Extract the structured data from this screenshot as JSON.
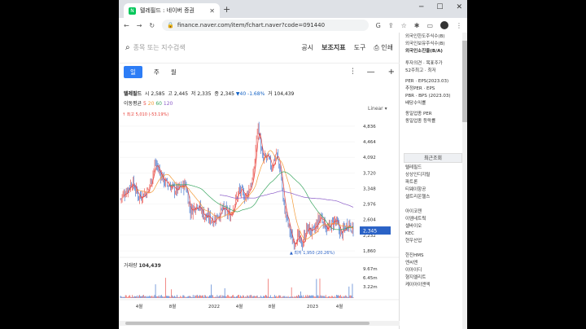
{
  "browser": {
    "tab_title": "텔레필드 : 네이버 증권",
    "favicon": "N",
    "url": "finance.naver.com/item/fchart.naver?code=091440"
  },
  "header": {
    "search_placeholder": "종목 또는 지수검색",
    "nav": [
      "공시",
      "보조지표",
      "도구",
      "인쇄"
    ]
  },
  "period_tabs": [
    "일",
    "주",
    "월"
  ],
  "info": {
    "name": "텔레필드",
    "open_label": "시",
    "open": "2,585",
    "high_label": "고",
    "high": "2,445",
    "low_label": "저",
    "low": "2,335",
    "close_label": "종",
    "close": "2,345",
    "change": "▼40 -1.68%",
    "volume_label": "거",
    "volume": "104,439"
  },
  "ma": {
    "label": "이동평균",
    "periods": [
      "5",
      "20",
      "60",
      "120"
    ]
  },
  "scale_label": "Linear",
  "colors": {
    "up": "#e8413a",
    "down": "#2a62c6",
    "ma5": "#e8413a",
    "ma20": "#f29a38",
    "ma60": "#3aa660",
    "ma120": "#8b5cc8",
    "accent": "#2d7df6"
  },
  "chart_data": {
    "type": "candlestick",
    "y_ticks": [
      "4,836",
      "4,464",
      "4,092",
      "3,720",
      "3,348",
      "2,976",
      "2,604",
      "2,232",
      "1,860"
    ],
    "ylim": [
      1860,
      5010
    ],
    "x_ticks": [
      "4월",
      "8월",
      "2022",
      "4월",
      "8월",
      "2023",
      "4월"
    ],
    "last_price": "2,345",
    "max_label": "최고 5,010 (-53.19%)",
    "min_label": "최저 1,950 (20.26%)",
    "volume_label": "거래량",
    "volume_value": "104,439",
    "volume_ticks": [
      "9.67m",
      "6.45m",
      "3.22m"
    ],
    "trend": [
      {
        "x": 0,
        "y": 3100
      },
      {
        "x": 5,
        "y": 3500
      },
      {
        "x": 8,
        "y": 3150
      },
      {
        "x": 12,
        "y": 3300
      },
      {
        "x": 15,
        "y": 3950
      },
      {
        "x": 19,
        "y": 3500
      },
      {
        "x": 24,
        "y": 3300
      },
      {
        "x": 28,
        "y": 3450
      },
      {
        "x": 30,
        "y": 2800
      },
      {
        "x": 33,
        "y": 3000
      },
      {
        "x": 36,
        "y": 2700
      },
      {
        "x": 40,
        "y": 2600
      },
      {
        "x": 44,
        "y": 2850
      },
      {
        "x": 47,
        "y": 2700
      },
      {
        "x": 51,
        "y": 3300
      },
      {
        "x": 54,
        "y": 3150
      },
      {
        "x": 57,
        "y": 3600
      },
      {
        "x": 59,
        "y": 4900
      },
      {
        "x": 61,
        "y": 4000
      },
      {
        "x": 63,
        "y": 4100
      },
      {
        "x": 65,
        "y": 3850
      },
      {
        "x": 67,
        "y": 4200
      },
      {
        "x": 69,
        "y": 3700
      },
      {
        "x": 70,
        "y": 3000
      },
      {
        "x": 72,
        "y": 2500
      },
      {
        "x": 74,
        "y": 2050
      },
      {
        "x": 76,
        "y": 2200
      },
      {
        "x": 78,
        "y": 2000
      },
      {
        "x": 80,
        "y": 2400
      },
      {
        "x": 83,
        "y": 2300
      },
      {
        "x": 86,
        "y": 2700
      },
      {
        "x": 89,
        "y": 2350
      },
      {
        "x": 92,
        "y": 2600
      },
      {
        "x": 95,
        "y": 2250
      },
      {
        "x": 98,
        "y": 2550
      },
      {
        "x": 100,
        "y": 2345
      }
    ]
  },
  "side_panel": {
    "top_rows": [
      "외국인한도주식수(B)",
      "외국인보유주식수(B)",
      "외국인소진율(B/A)"
    ],
    "mid_rows": [
      "투자의견 · 목표주가",
      "52주최고 · 최저"
    ],
    "per_rows": [
      "PER · EPS(2023.03)",
      "추정PER · EPS",
      "PBR · BPS (2023.03)",
      "배당수익률"
    ],
    "sector_rows": [
      "동일업종 PER",
      "동일업종 등락률"
    ],
    "recent_title": "최근조회",
    "recent_items": [
      "텔레필드",
      "상상인디지털",
      "파트론",
      "티웨이항공",
      "셀트리온헬스",
      "",
      "아이코젠",
      "이엠네트웍",
      "셀바이오",
      "KEC",
      "현우산업",
      "",
      "한진HMS",
      "엔씨엔",
      "이아이디",
      "형지엘리트",
      "케이아이엔엑"
    ]
  }
}
